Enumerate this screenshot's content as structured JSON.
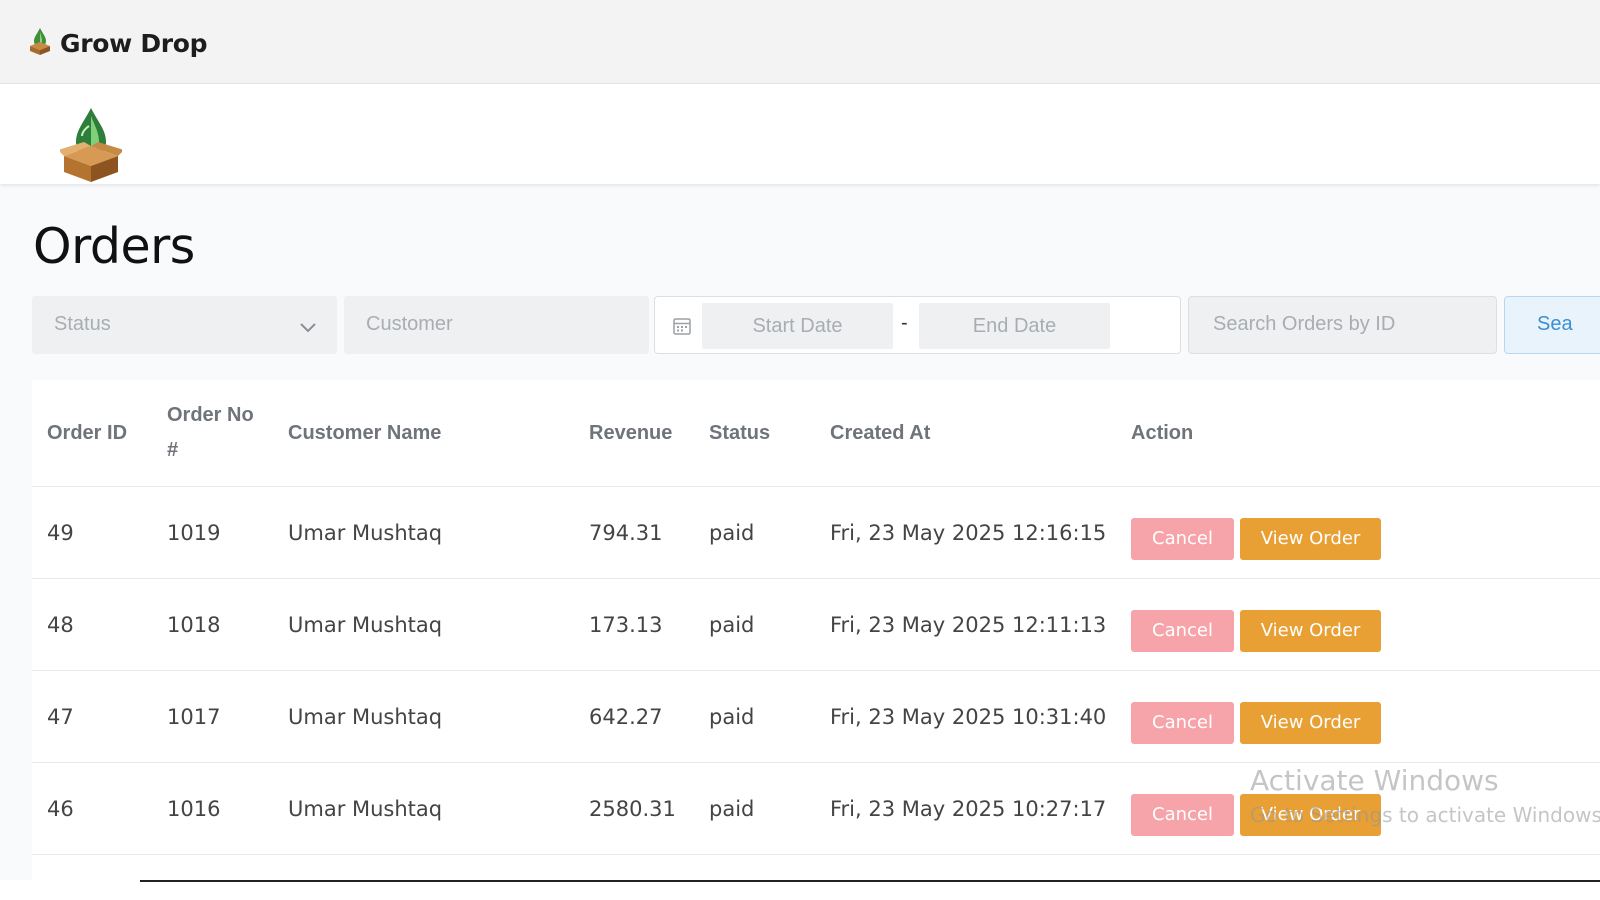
{
  "app": {
    "name": "Grow Drop"
  },
  "page": {
    "title": "Orders"
  },
  "filters": {
    "status_placeholder": "Status",
    "customer_placeholder": "Customer",
    "start_date_placeholder": "Start Date",
    "date_separator": "-",
    "end_date_placeholder": "End Date",
    "search_placeholder": "Search Orders by ID",
    "search_button": "Sea"
  },
  "table": {
    "headers": {
      "order_id": "Order ID",
      "order_no_line1": "Order No",
      "order_no_line2": "#",
      "customer_name": "Customer Name",
      "revenue": "Revenue",
      "status": "Status",
      "created_at": "Created At",
      "action": "Action"
    },
    "rows": [
      {
        "order_id": "49",
        "order_no": "1019",
        "customer": "Umar Mushtaq",
        "revenue": "794.31",
        "status": "paid",
        "created_at": "Fri, 23 May 2025 12:16:15"
      },
      {
        "order_id": "48",
        "order_no": "1018",
        "customer": "Umar Mushtaq",
        "revenue": "173.13",
        "status": "paid",
        "created_at": "Fri, 23 May 2025 12:11:13"
      },
      {
        "order_id": "47",
        "order_no": "1017",
        "customer": "Umar Mushtaq",
        "revenue": "642.27",
        "status": "paid",
        "created_at": "Fri, 23 May 2025 10:31:40"
      },
      {
        "order_id": "46",
        "order_no": "1016",
        "customer": "Umar Mushtaq",
        "revenue": "2580.31",
        "status": "paid",
        "created_at": "Fri, 23 May 2025 10:27:17"
      }
    ],
    "cancel_label": "Cancel",
    "view_label": "View Order"
  },
  "watermark": {
    "line1": "Activate Windows",
    "line2": "Go to Settings to activate Windows."
  },
  "colors": {
    "cancel": "#f6a4a9",
    "view": "#e8a035",
    "search_button_text": "#3b8fd3"
  }
}
